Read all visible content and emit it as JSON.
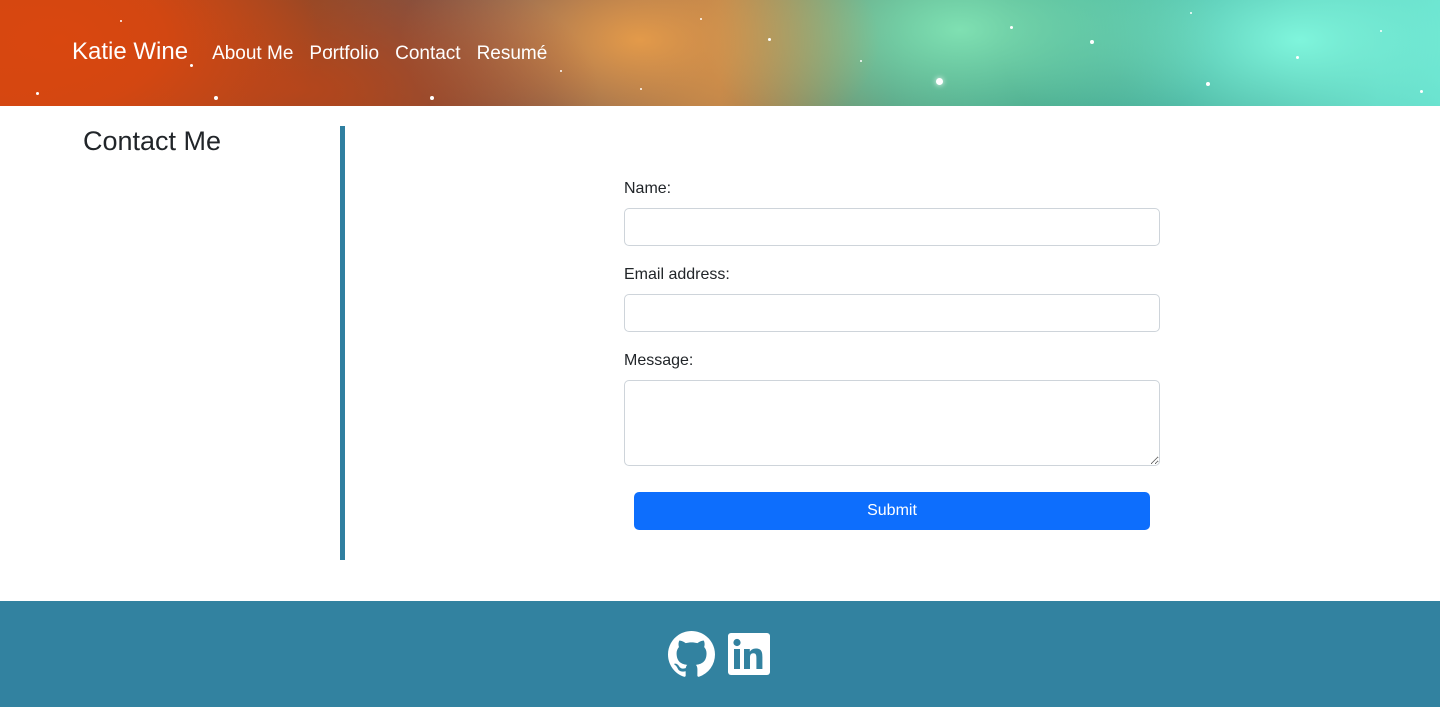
{
  "navbar": {
    "brand": "Katie Wine",
    "links": [
      {
        "label": "About Me"
      },
      {
        "label": "Portfolio"
      },
      {
        "label": "Contact"
      },
      {
        "label": "Resumé"
      }
    ]
  },
  "contact": {
    "title": "Contact Me",
    "form": {
      "name_label": "Name:",
      "name_value": "",
      "email_label": "Email address:",
      "email_value": "",
      "message_label": "Message:",
      "message_value": "",
      "submit_label": "Submit"
    }
  },
  "footer": {
    "icons": [
      {
        "name": "github-icon"
      },
      {
        "name": "linkedin-icon"
      }
    ]
  },
  "colors": {
    "accent": "#3282a0",
    "divider": "#2f7fa0",
    "button": "#0d6efd",
    "text": "#212529"
  }
}
